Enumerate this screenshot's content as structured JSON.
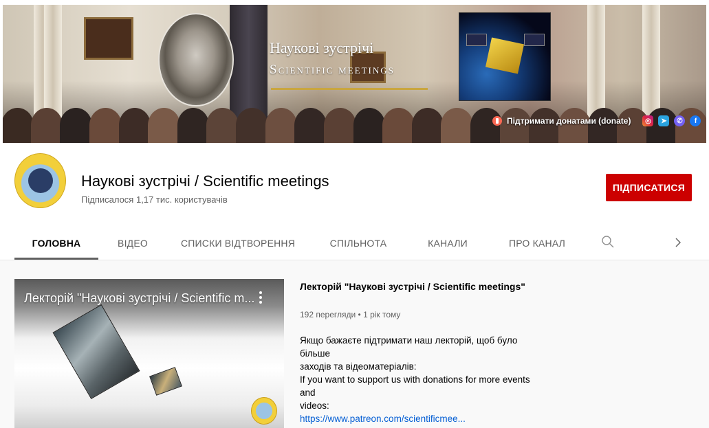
{
  "banner": {
    "title_ua": "Наукові зустрічі",
    "title_en": "Scientific meetings",
    "donate_label": "Підтримати донатами (donate)",
    "social_icons": [
      "instagram-icon",
      "telegram-icon",
      "viber-icon",
      "facebook-icon"
    ],
    "colors": {
      "rule": "#c9a640",
      "donate": "#f96854"
    }
  },
  "channel": {
    "name": "Наукові зустрічі / Scientific meetings",
    "subscribers": "Підписалося 1,17 тис. користувачів",
    "subscribe_label": "ПІДПИСАТИСЯ",
    "colors": {
      "subscribe_bg": "#cc0000"
    }
  },
  "tabs": [
    {
      "label": "ГОЛОВНА",
      "active": true
    },
    {
      "label": "ВІДЕО",
      "active": false
    },
    {
      "label": "СПИСКИ ВІДТВОРЕННЯ",
      "active": false
    },
    {
      "label": "СПІЛЬНОТА",
      "active": false
    },
    {
      "label": "КАНАЛИ",
      "active": false
    },
    {
      "label": "ПРО КАНАЛ",
      "active": false
    }
  ],
  "tab_icons": {
    "search": "search-icon",
    "next": "chevron-right-icon"
  },
  "featured_video": {
    "thumbnail_title": "Лекторій \"Наукові зустрічі / Scientific m...",
    "title": "Лекторій \"Наукові зустрічі / Scientific meetings\"",
    "meta": "192 перегляди • 1 рік тому",
    "description": [
      "Якщо бажаєте підтримати наш лекторій, щоб було більше",
      "заходів та відеоматеріалів:",
      "If you want to support us with donations for more events and",
      "videos:"
    ],
    "link": "https://www.patreon.com/scientificmee...",
    "colors": {
      "link": "#065fd4"
    }
  }
}
